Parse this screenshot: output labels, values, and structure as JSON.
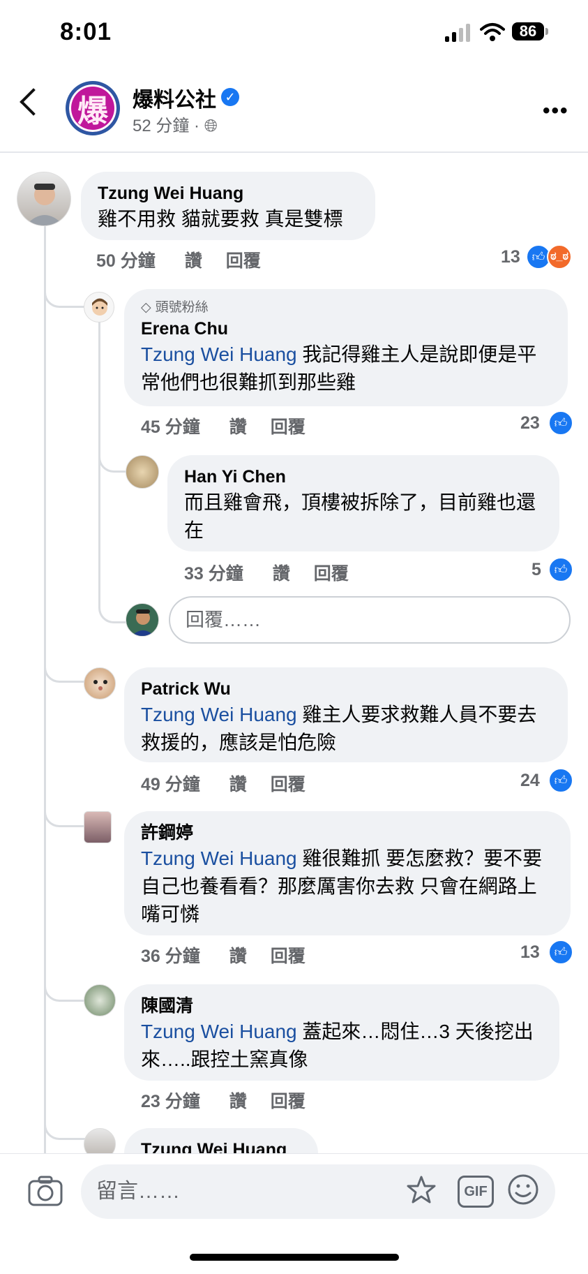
{
  "status_bar": {
    "time": "8:01",
    "battery": "86"
  },
  "header": {
    "page_name": "爆料公社",
    "avatar_text": "爆",
    "meta": "52 分鐘 ·"
  },
  "comments": [
    {
      "author": "Tzung Wei Huang",
      "text": "雞不用救 貓就要救 真是雙標",
      "time": "50 分鐘",
      "like_label": "讚",
      "reply_label": "回覆",
      "reactions": "13"
    },
    {
      "badge": "頭號粉絲",
      "author": "Erena Chu",
      "mention": "Tzung Wei Huang",
      "text": " 我記得雞主人是說即便是平常他們也很難抓到那些雞",
      "time": "45 分鐘",
      "like_label": "讚",
      "reply_label": "回覆",
      "reactions": "23"
    },
    {
      "author": "Han Yi Chen",
      "text": "而且雞會飛，頂樓被拆除了，目前雞也還在",
      "time": "33 分鐘",
      "like_label": "讚",
      "reply_label": "回覆",
      "reactions": "5"
    },
    {
      "author": "Patrick Wu",
      "mention": "Tzung Wei Huang",
      "text": " 雞主人要求救難人員不要去救援的，應該是怕危險",
      "time": "49 分鐘",
      "like_label": "讚",
      "reply_label": "回覆",
      "reactions": "24"
    },
    {
      "author": "許鋼婷",
      "mention": "Tzung Wei Huang",
      "text": " 雞很難抓 要怎麼救？要不要自己也養看看？那麼厲害你去救 只會在網路上嘴可憐",
      "time": "36 分鐘",
      "like_label": "讚",
      "reply_label": "回覆",
      "reactions": "13"
    },
    {
      "author": "陳國清",
      "mention": "Tzung Wei Huang",
      "text": " 蓋起來…悶住…3 天後挖出來…..跟控土窯真像",
      "time": "23 分鐘",
      "like_label": "讚",
      "reply_label": "回覆"
    },
    {
      "author": "Tzung Wei Huang"
    }
  ],
  "reply_box": {
    "placeholder": "回覆……"
  },
  "comment_input": {
    "placeholder": "留言……",
    "gif_label": "GIF"
  }
}
